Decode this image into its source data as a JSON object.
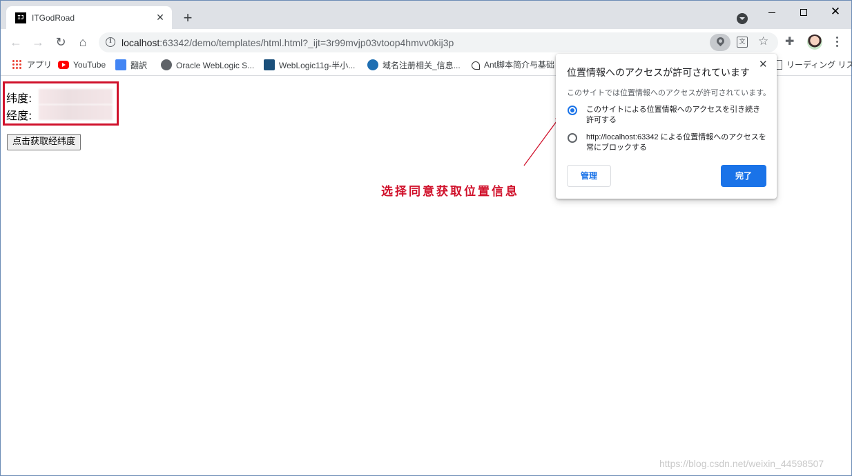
{
  "browser": {
    "tab": {
      "title": "ITGodRoad",
      "favicon_text": "IJ",
      "close": "✕"
    },
    "new_tab": "+",
    "window_controls": {
      "close": "✕"
    },
    "address_bar": {
      "host": "localhost",
      "path": ":63342/demo/templates/html.html?_ijt=3r99mvjp03vtoop4hmvv0kij3p"
    }
  },
  "bookmarks": [
    {
      "label": "アプリ",
      "icon": "apps-grid-icon"
    },
    {
      "label": "YouTube",
      "icon": "youtube-icon"
    },
    {
      "label": "翻訳",
      "icon": "google-translate-icon"
    },
    {
      "label": "Oracle WebLogic S...",
      "icon": "globe-icon"
    },
    {
      "label": "WebLogic11g-半小...",
      "icon": "c-icon"
    },
    {
      "label": "域名注册相关_信息...",
      "icon": "vs-icon"
    },
    {
      "label": "Ant脚本简介与基础",
      "icon": "ant-icon"
    },
    {
      "label": "リーディング リスト",
      "icon": "reading-list-icon"
    }
  ],
  "page": {
    "latitude_label": "纬度:",
    "longitude_label": "经度:",
    "get_location_button": "点击获取经纬度",
    "annotation": "选择同意获取位置信息",
    "watermark": "https://blog.csdn.net/weixin_44598507"
  },
  "permission_bubble": {
    "title": "位置情報へのアクセスが許可されています",
    "close": "✕",
    "description": "このサイトでは位置情報へのアクセスが許可されています。",
    "options": [
      {
        "label": "このサイトによる位置情報へのアクセスを引き続き許可する",
        "selected": true
      },
      {
        "label": "http://localhost:63342 による位置情報へのアクセスを常にブロックする",
        "selected": false
      }
    ],
    "manage_button": "管理",
    "done_button": "完了"
  },
  "colors": {
    "accent": "#1a73e8",
    "annotation": "#d0112b",
    "tabstrip": "#dee1e6"
  }
}
